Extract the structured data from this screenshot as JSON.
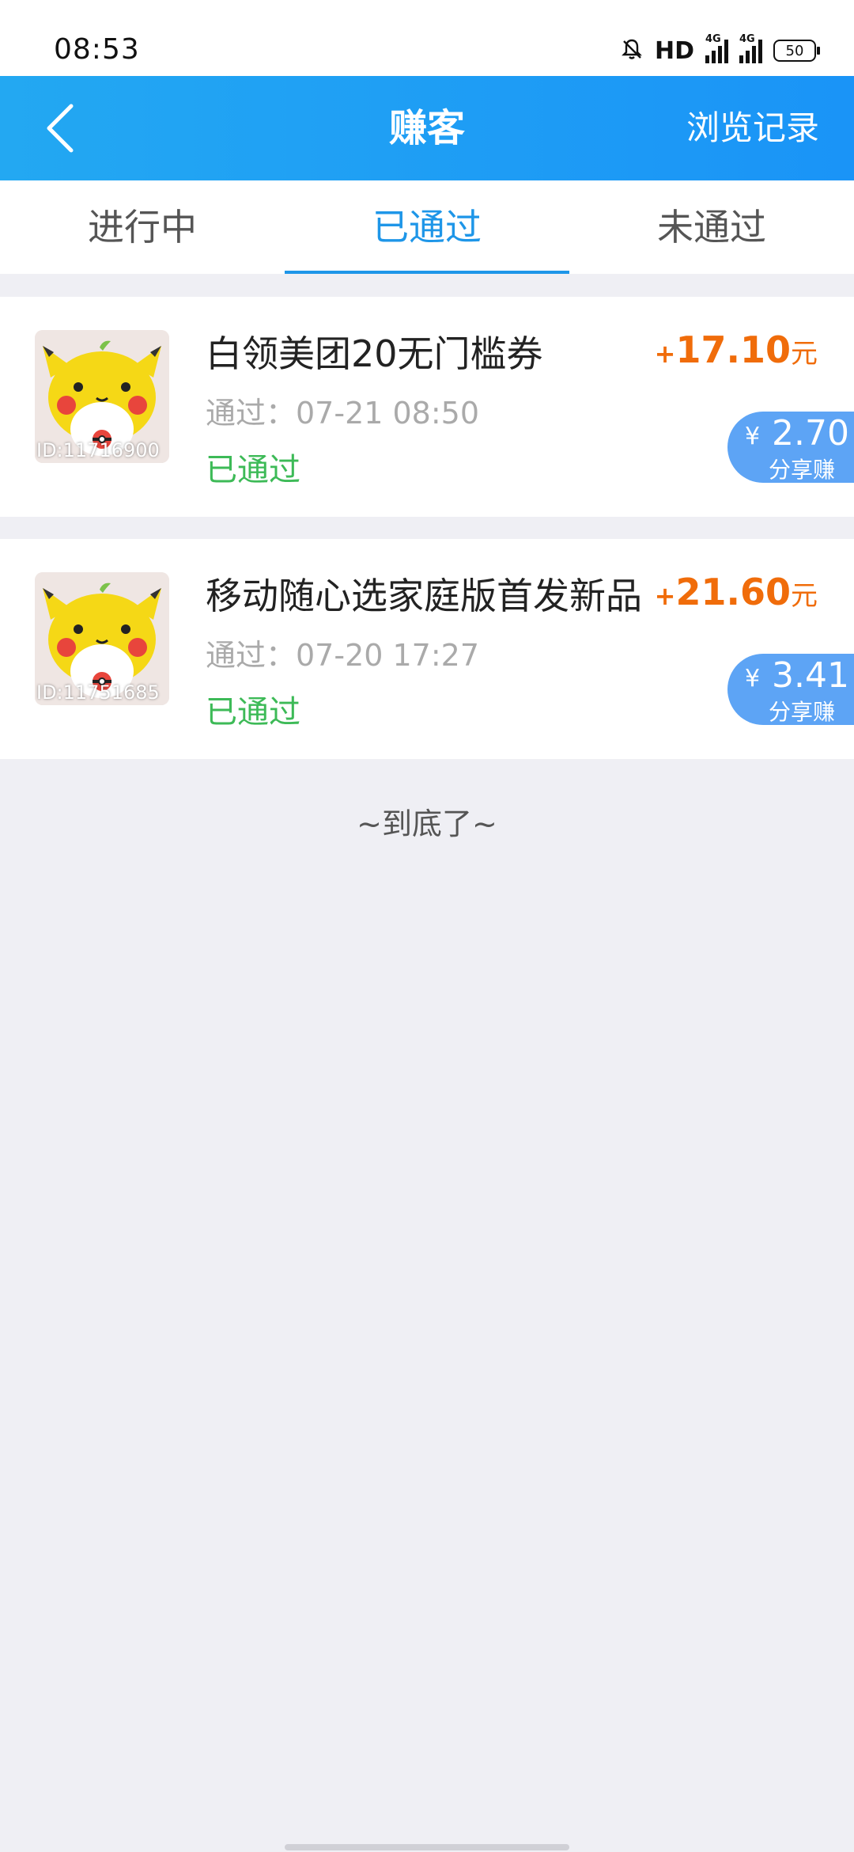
{
  "status_bar": {
    "time": "08:53",
    "hd_label": "HD",
    "network_1": "4G",
    "network_2": "4G",
    "battery": "50"
  },
  "header": {
    "title": "赚客",
    "right_link": "浏览记录",
    "back_icon": "chevron-left-icon"
  },
  "tabs": [
    {
      "label": "进行中",
      "active": false
    },
    {
      "label": "已通过",
      "active": true
    },
    {
      "label": "未通过",
      "active": false
    }
  ],
  "items": [
    {
      "title": "白领美团20无门槛券",
      "time": "通过：07-21 08:50",
      "status": "已通过",
      "reward_plus": "+",
      "reward_amount": "17.10",
      "reward_unit": "元",
      "share_currency": "¥",
      "share_amount": "2.70",
      "share_label": "分享赚",
      "avatar_id": "ID:11716900"
    },
    {
      "title": "移动随心选家庭版首发新品",
      "time": "通过：07-20 17:27",
      "status": "已通过",
      "reward_plus": "+",
      "reward_amount": "21.60",
      "reward_unit": "元",
      "share_currency": "¥",
      "share_amount": "3.41",
      "share_label": "分享赚",
      "avatar_id": "ID:11751685"
    }
  ],
  "footer": {
    "end_text": "~到底了~"
  },
  "colors": {
    "header_bg": "#1a94f7",
    "active_tab": "#1e96e8",
    "reward": "#f06c0a",
    "status_passed": "#3dba57",
    "share_badge": "#5da4f5",
    "page_bg": "#efeff4"
  }
}
